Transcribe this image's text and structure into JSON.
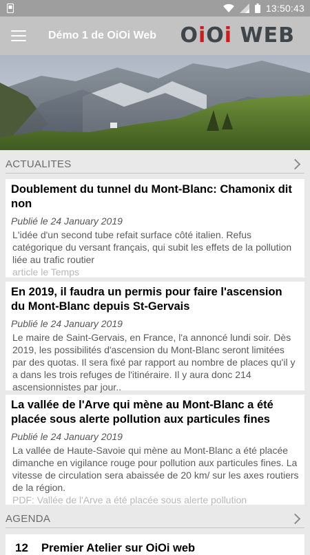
{
  "status_bar": {
    "time": "13:50:43",
    "icons": [
      "notification-icon",
      "wifi-icon",
      "signal-icon",
      "battery-icon"
    ]
  },
  "app_bar": {
    "title": "Démo 1 de OiOi Web",
    "logo": {
      "part1": "O",
      "part2": "i",
      "part3": "O",
      "part4": "i",
      "part5": " WEB"
    },
    "colors": {
      "bar": "#c3c3c3",
      "logo_dark": "#3f4549",
      "logo_accent": "#c71e1e"
    }
  },
  "sections": {
    "news": {
      "title": "ACTUALITES",
      "articles": [
        {
          "title": "Doublement du tunnel du Mont-Blanc: Chamonix dit non",
          "date": "Publié le 24 January 2019",
          "summary": "L'idée d'un second tube refait surface côté italien. Refus catégorique du versant français, qui subit les effets de la pollution liée au trafic routier",
          "source": "article le Temps"
        },
        {
          "title": "En 2019, il faudra un permis pour faire l'ascension du Mont-Blanc depuis St-Gervais",
          "date": "Publié le 24 January 2019",
          "summary": "Le maire de Saint-Gervais, en France, l'a annoncé lundi soir. Dès 2019, les possibilités d'ascension du Mont-Blanc seront limitées par des quotas. Il sera fixé par rapport au nombre de places qu'il y a dans les trois refuges de l'itinéraire. Il y aura donc 214 ascensionnistes par jour..",
          "source": ""
        },
        {
          "title": "La vallée de l'Arve qui mène au Mont-Blanc a été placée sous alerte pollution aux particules fines",
          "date": "Publié le 24 January 2019",
          "summary": "La vallée de Haute-Savoie qui mène au Mont-Blanc a été placée dimanche en vigilance rouge pour pollution aux particules fines. La vitesse de circulation sera abaissée de 20 km/ sur les axes routiers de la région.",
          "source": "PDF: Vallée de l'Arve a été placée sous alerte pollution"
        }
      ]
    },
    "agenda": {
      "title": "AGENDA",
      "events": [
        {
          "day": "12",
          "title": "Premier Atelier sur OiOi web"
        }
      ]
    }
  }
}
